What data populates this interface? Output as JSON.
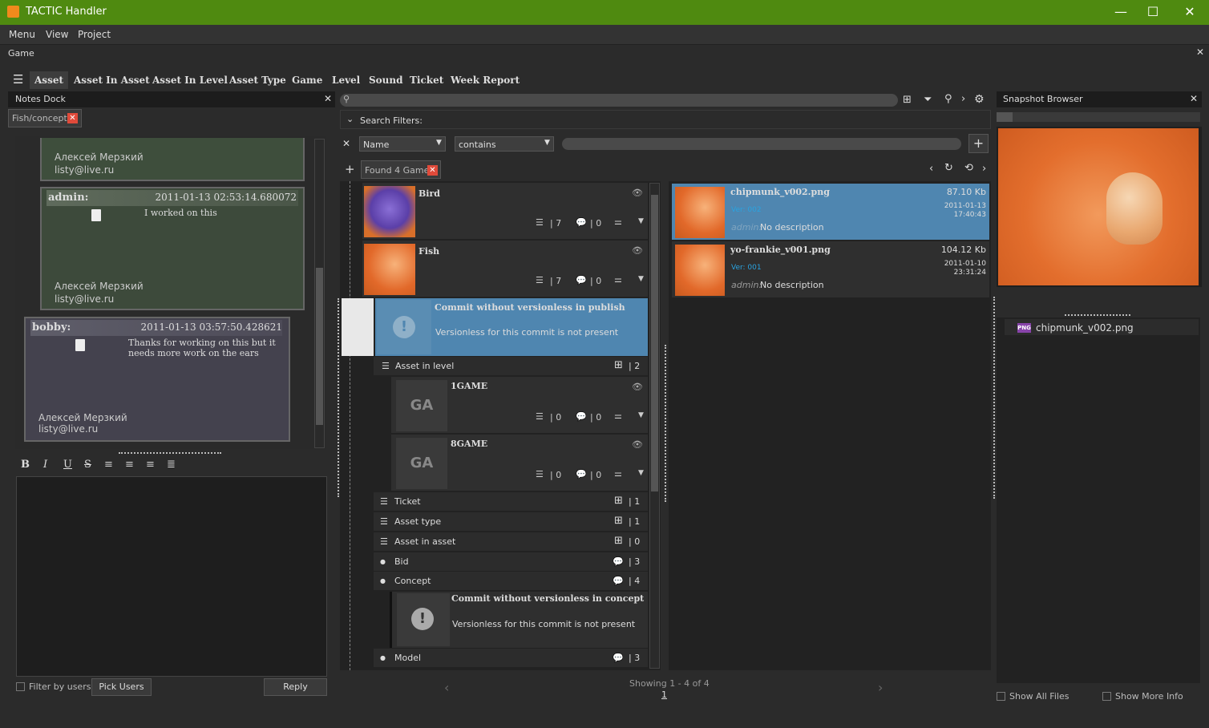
{
  "window": {
    "title": "TACTIC Handler",
    "min": "—",
    "max": "☐",
    "close": "✕"
  },
  "menu": [
    "Menu",
    "View",
    "Project"
  ],
  "project": "Game",
  "tabs": [
    "Asset",
    "Asset In Asset",
    "Asset In Level",
    "Asset Type",
    "Game",
    "Level",
    "Sound",
    "Ticket",
    "Week Report"
  ],
  "notes": {
    "title": "Notes Dock",
    "chip": "Fish/concept",
    "note0": {
      "sig_name": "Алексей Мерзкий",
      "sig_mail": "listy@live.ru"
    },
    "note1": {
      "who": "admin:",
      "ts": "2011-01-13 02:53:14.680072",
      "msg": "I worked on this",
      "sig_name": "Алексей Мерзкий",
      "sig_mail": "listy@live.ru"
    },
    "note2": {
      "who": "bobby:",
      "ts": "2011-01-13 03:57:50.428621",
      "msg": "Thanks for working on this but it needs more work on the ears",
      "sig_name": "Алексей Мерзкий",
      "sig_mail": "listy@live.ru"
    },
    "filter_label": "Filter by users",
    "pick_users": "Pick Users",
    "reply": "Reply"
  },
  "search": {
    "filters_label": "Search Filters:",
    "field": "Name",
    "op": "contains",
    "found": "Found 4 Game"
  },
  "items": {
    "bird": {
      "name": "Bird",
      "tasks": "| 7",
      "notes": "| 0"
    },
    "fish": {
      "name": "Fish",
      "tasks": "| 7",
      "notes": "| 0"
    },
    "warn1": {
      "title": "Commit without versionless in publish",
      "text": "Versionless for this commit is not present"
    },
    "asset_in_level": {
      "label": "Asset in level",
      "count": "| 2"
    },
    "g1": {
      "name": "1GAME",
      "abbr": "GA",
      "tasks": "| 0",
      "notes": "| 0"
    },
    "g8": {
      "name": "8GAME",
      "abbr": "GA",
      "tasks": "| 0",
      "notes": "| 0"
    },
    "ticket": {
      "label": "Ticket",
      "count": "| 1"
    },
    "asset_type": {
      "label": "Asset type",
      "count": "| 1"
    },
    "asset_in_asset": {
      "label": "Asset in asset",
      "count": "| 0"
    },
    "bid": {
      "label": "Bid",
      "count": "| 3"
    },
    "concept": {
      "label": "Concept",
      "count": "| 4"
    },
    "warn2": {
      "title": "Commit without versionless in concept",
      "text": "Versionless for this commit is not present"
    },
    "model": {
      "label": "Model",
      "count": "| 3"
    }
  },
  "pager": {
    "showing": "Showing 1 - 4 of 4",
    "page": "1"
  },
  "snapshots": [
    {
      "file": "chipmunk_v002.png",
      "size": "87.10  Kb",
      "ver": "Ver: 002",
      "date": "2011-01-13",
      "time": "17:40:43",
      "user": "admin:",
      "desc": "No description"
    },
    {
      "file": "yo-frankie_v001.png",
      "size": "104.12  Kb",
      "ver": "Ver: 001",
      "date": "2011-01-10",
      "time": "23:31:24",
      "user": "admin:",
      "desc": "No description"
    }
  ],
  "browser": {
    "title": "Snapshot Browser",
    "file": "chipmunk_v002.png",
    "show_all": "Show All Files",
    "show_more": "Show More Info"
  },
  "colors": {
    "titlebar": "#4f8a10",
    "selection": "#4f86b0",
    "panel": "#222222"
  }
}
